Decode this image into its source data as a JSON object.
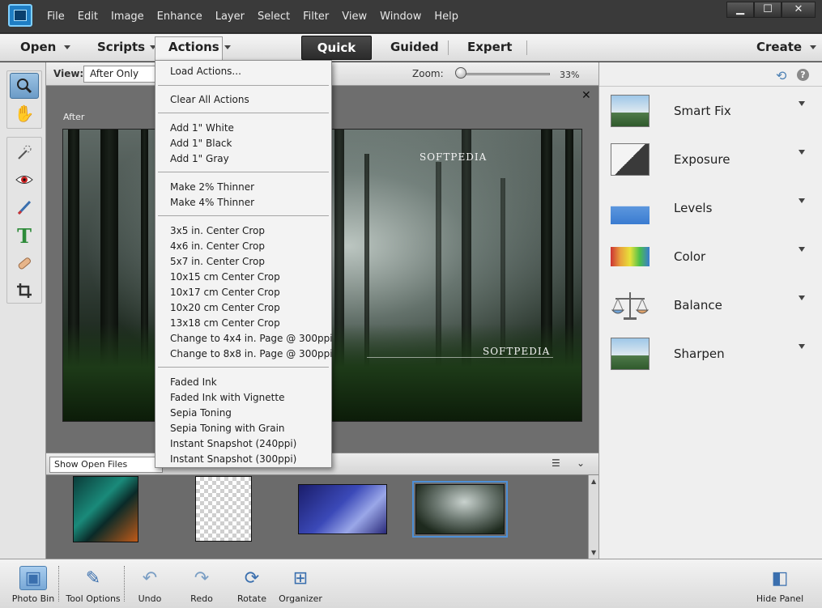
{
  "menu": [
    "File",
    "Edit",
    "Image",
    "Enhance",
    "Layer",
    "Select",
    "Filter",
    "View",
    "Window",
    "Help"
  ],
  "window_buttons": {
    "minimize": "▁",
    "maximize": "☐",
    "close": "✕"
  },
  "modebar": {
    "open": "Open",
    "scripts": "Scripts",
    "actions": "Actions",
    "quick": "Quick",
    "guided": "Guided",
    "expert": "Expert",
    "create": "Create"
  },
  "viewbar": {
    "view_label": "View:",
    "view_value": "After Only",
    "zoom_label": "Zoom:",
    "zoom_value": "33%",
    "zoom_fraction": 0.33
  },
  "canvas": {
    "after_label": "After",
    "watermark_top": "SOFTPEDIA",
    "watermark_bottom": "SOFTPEDIA"
  },
  "actions_menu": {
    "groups": [
      [
        "Load Actions..."
      ],
      [
        "Clear All Actions"
      ],
      [
        "Add 1\" White",
        "Add 1\" Black",
        "Add 1\" Gray"
      ],
      [
        "Make 2% Thinner",
        "Make 4% Thinner"
      ],
      [
        "3x5 in. Center Crop",
        "4x6 in. Center Crop",
        "5x7 in. Center Crop",
        "10x15 cm Center Crop",
        "10x17 cm Center Crop",
        "10x20 cm Center Crop",
        "13x18 cm Center Crop",
        "Change to 4x4 in. Page @ 300ppi",
        "Change to 8x8 in. Page @ 300ppi"
      ],
      [
        "Faded Ink",
        "Faded Ink with Vignette",
        "Sepia Toning",
        "Sepia Toning with Grain",
        "Instant Snapshot (240ppi)",
        "Instant Snapshot (300ppi)"
      ]
    ]
  },
  "photo_bin": {
    "show_label": "Show Open Files"
  },
  "adjustments": [
    {
      "label": "Smart Fix",
      "icon": "smart-fix-icon"
    },
    {
      "label": "Exposure",
      "icon": "exposure-icon"
    },
    {
      "label": "Levels",
      "icon": "levels-icon"
    },
    {
      "label": "Color",
      "icon": "color-icon"
    },
    {
      "label": "Balance",
      "icon": "balance-icon"
    },
    {
      "label": "Sharpen",
      "icon": "sharpen-icon"
    }
  ],
  "bottombar": {
    "photo_bin": "Photo Bin",
    "tool_options": "Tool Options",
    "undo": "Undo",
    "redo": "Redo",
    "rotate": "Rotate",
    "organizer": "Organizer",
    "hide_panel": "Hide Panel"
  },
  "colors": {
    "accent": "#4d8fd6",
    "dark_chrome": "#3a3a3a",
    "panel_bg": "#efefef"
  }
}
